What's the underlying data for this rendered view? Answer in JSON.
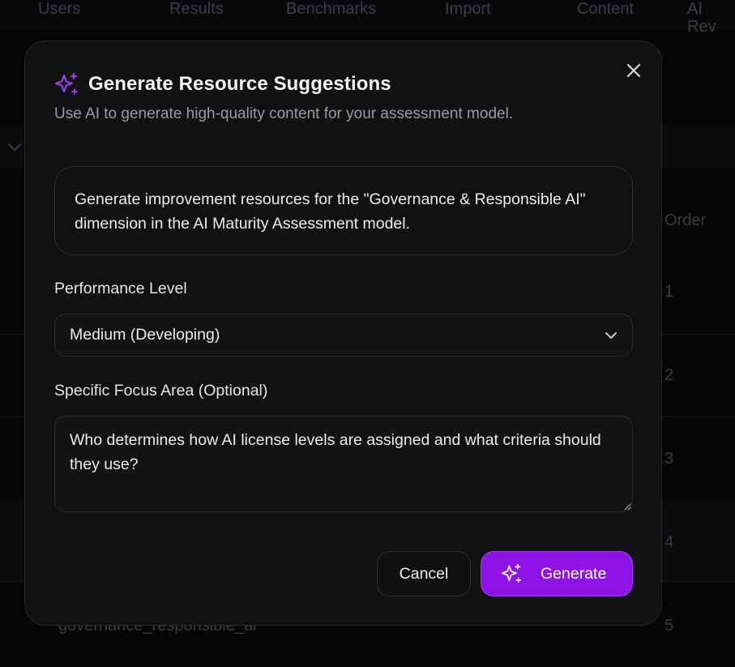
{
  "background": {
    "nav_items": [
      "Users",
      "Results",
      "Benchmarks",
      "Import",
      "Content",
      "AI Rev"
    ],
    "column_header": "Order",
    "order_values": [
      "1",
      "2",
      "3",
      "4",
      "5"
    ],
    "last_row_text": "governance_responsible_ai"
  },
  "modal": {
    "title": "Generate Resource Suggestions",
    "subtitle": "Use AI to generate high-quality content for your assessment model.",
    "prompt_text": "Generate improvement resources for the \"Governance & Responsible AI\" dimension in the AI Maturity Assessment model.",
    "performance_label": "Performance Level",
    "performance_value": "Medium (Developing)",
    "focus_label": "Specific Focus Area (Optional)",
    "focus_value": "Who determines how AI license levels are assigned and what criteria should they use?",
    "cancel_label": "Cancel",
    "generate_label": "Generate",
    "icons": {
      "title": "sparkles-icon",
      "close": "close-icon",
      "select": "chevron-down-icon",
      "generate": "sparkles-icon"
    }
  },
  "colors": {
    "accent": "#8d13e6",
    "accent_icon": "#a93cf5",
    "modal_bg": "#111113",
    "page_bg": "#050506"
  }
}
